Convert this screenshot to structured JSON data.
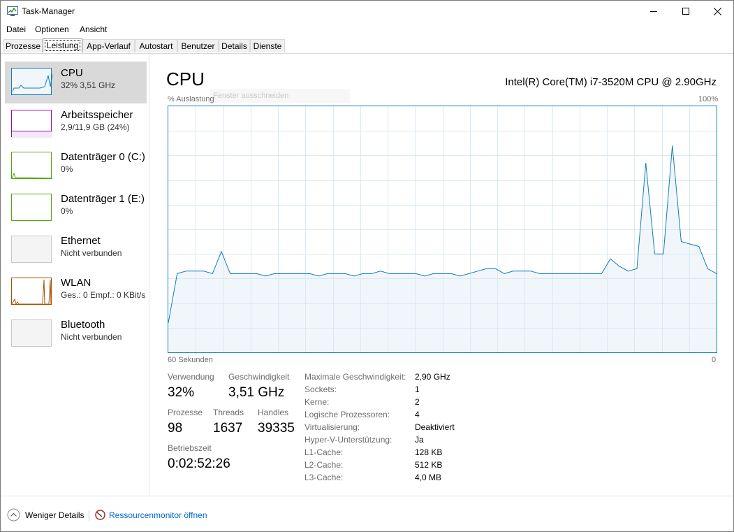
{
  "window": {
    "title": "Task-Manager"
  },
  "menu": [
    "Datei",
    "Optionen",
    "Ansicht"
  ],
  "tabs": [
    "Prozesse",
    "Leistung",
    "App-Verlauf",
    "Autostart",
    "Benutzer",
    "Details",
    "Dienste"
  ],
  "active_tab": "Leistung",
  "sidebar": [
    {
      "name": "CPU",
      "sub": "32% 3,51 GHz",
      "color": "#117dbb",
      "icon": "cpu-graph-icon"
    },
    {
      "name": "Arbeitsspeicher",
      "sub": "2,9/11,9 GB (24%)",
      "color": "#8b12ae",
      "icon": "memory-graph-icon"
    },
    {
      "name": "Datenträger 0 (C:)",
      "sub": "0%",
      "color": "#4da60c",
      "icon": "disk-graph-icon"
    },
    {
      "name": "Datenträger 1 (E:)",
      "sub": "0%",
      "color": "#4da60c",
      "icon": "disk-graph-icon"
    },
    {
      "name": "Ethernet",
      "sub": "Nicht verbunden",
      "color": "#c8c8c8",
      "icon": "ethernet-graph-icon"
    },
    {
      "name": "WLAN",
      "sub": "Ges.: 0 Empf.: 0 KBit/s",
      "color": "#a74f01",
      "icon": "wlan-graph-icon"
    },
    {
      "name": "Bluetooth",
      "sub": "Nicht verbunden",
      "color": "#c8c8c8",
      "icon": "bluetooth-graph-icon"
    }
  ],
  "main": {
    "title": "CPU",
    "model": "Intel(R) Core(TM) i7-3520M CPU @ 2.90GHz",
    "graph_label": "% Auslastung",
    "graph_max": "100%",
    "x_left": "60 Sekunden",
    "x_right": "0",
    "ghost_text": "Fenster ausschneiden"
  },
  "stats": {
    "usage_label": "Verwendung",
    "usage": "32%",
    "speed_label": "Geschwindigkeit",
    "speed": "3,51 GHz",
    "procs_label": "Prozesse",
    "procs": "98",
    "threads_label": "Threads",
    "threads": "1637",
    "handles_label": "Handles",
    "handles": "39335",
    "uptime_label": "Betriebszeit",
    "uptime": "0:02:52:26"
  },
  "info": [
    {
      "label": "Maximale Geschwindigkeit:",
      "value": "2,90 GHz"
    },
    {
      "label": "Sockets:",
      "value": "1"
    },
    {
      "label": "Kerne:",
      "value": "2"
    },
    {
      "label": "Logische Prozessoren:",
      "value": "4"
    },
    {
      "label": "Virtualisierung:",
      "value": "Deaktiviert"
    },
    {
      "label": "Hyper-V-Unterstützung:",
      "value": "Ja"
    },
    {
      "label": "L1-Cache:",
      "value": "128 KB"
    },
    {
      "label": "L2-Cache:",
      "value": "512 KB"
    },
    {
      "label": "L3-Cache:",
      "value": "4,0 MB"
    }
  ],
  "footer": {
    "less_details": "Weniger Details",
    "resmon": "Ressourcenmonitor öffnen"
  },
  "chart_data": {
    "type": "area",
    "xlabel": "60 Sekunden",
    "ylabel": "% Auslastung",
    "ylim": [
      0,
      100
    ],
    "x": [
      60,
      59,
      58,
      57,
      56,
      55,
      54,
      53,
      52,
      51,
      50,
      49,
      48,
      47,
      46,
      45,
      44,
      43,
      42,
      41,
      40,
      39,
      38,
      37,
      36,
      35,
      34,
      33,
      32,
      31,
      30,
      29,
      28,
      27,
      26,
      25,
      24,
      23,
      22,
      21,
      20,
      19,
      18,
      17,
      16,
      15,
      14,
      13,
      12,
      11,
      10,
      9,
      8,
      7,
      6,
      5,
      4,
      3,
      2,
      1,
      0
    ],
    "series": [
      {
        "values": [
          12,
          32,
          33,
          33,
          33,
          32,
          41,
          32,
          32,
          32,
          32,
          31,
          32,
          32,
          32,
          32,
          32,
          31,
          32,
          32,
          32,
          31,
          32,
          32,
          33,
          32,
          32,
          32,
          32,
          31,
          32,
          32,
          32,
          31,
          32,
          33,
          34,
          34,
          32,
          33,
          33,
          33,
          32,
          32,
          32,
          32,
          32,
          32,
          32,
          32,
          38,
          35,
          33,
          34,
          77,
          40,
          40,
          84,
          45,
          44,
          43,
          34,
          32
        ]
      }
    ]
  }
}
